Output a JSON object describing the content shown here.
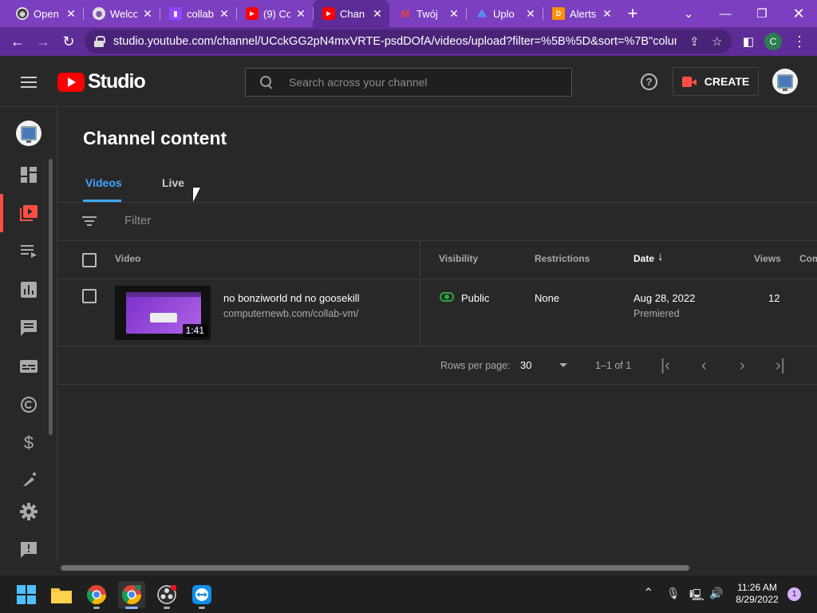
{
  "browser": {
    "tabs": [
      {
        "title": "Open",
        "icon": "github-icon",
        "color": "#e0e0e0"
      },
      {
        "title": "Welco",
        "icon": "globe-icon",
        "color": "#e0e0e0"
      },
      {
        "title": "collab",
        "icon": "twitch-icon",
        "color": "#9146ff"
      },
      {
        "title": "(9) Co",
        "icon": "youtube-icon",
        "color": "#ff0000"
      },
      {
        "title": "Chan",
        "icon": "youtube-icon",
        "color": "#ff0000"
      },
      {
        "title": "Twój",
        "icon": "gmail-icon",
        "color": "#ea4335"
      },
      {
        "title": "Uplo",
        "icon": "upload-icon",
        "color": "#4fa3ff"
      },
      {
        "title": "Alerts",
        "icon": "alerts-icon",
        "color": "#ff9000"
      }
    ],
    "active_tab_index": 4,
    "url": "studio.youtube.com/channel/UCckGG2pN4mxVRTE-psdDOfA/videos/upload?filter=%5B%5D&sort=%7B\"column...",
    "profile_initial": "C"
  },
  "header": {
    "logo_text": "Studio",
    "search_placeholder": "Search across your channel",
    "create_label": "CREATE"
  },
  "sidebar": {
    "items": [
      {
        "name": "dashboard-icon"
      },
      {
        "name": "content-icon",
        "active": true
      },
      {
        "name": "playlists-icon"
      },
      {
        "name": "analytics-icon"
      },
      {
        "name": "comments-icon"
      },
      {
        "name": "subtitles-icon"
      },
      {
        "name": "copyright-icon"
      },
      {
        "name": "earn-icon"
      },
      {
        "name": "customization-icon"
      },
      {
        "name": "settings-icon"
      },
      {
        "name": "feedback-icon"
      }
    ]
  },
  "main": {
    "title": "Channel content",
    "tabs": [
      {
        "label": "Videos",
        "active": true
      },
      {
        "label": "Live",
        "active": false
      }
    ],
    "filter_placeholder": "Filter",
    "columns": {
      "video": "Video",
      "visibility": "Visibility",
      "restrictions": "Restrictions",
      "date": "Date",
      "views": "Views",
      "comments": "Com"
    },
    "rows": [
      {
        "title": "no bonziworld nd no goosekill",
        "description": "computernewb.com/collab-vm/",
        "duration": "1:41",
        "visibility": "Public",
        "restrictions": "None",
        "date": "Aug 28, 2022",
        "date_sub": "Premiered",
        "views": "12"
      }
    ],
    "pagination": {
      "rows_per_page_label": "Rows per page:",
      "rows_per_page": "30",
      "range": "1–1 of 1"
    }
  },
  "taskbar": {
    "time": "11:26 AM",
    "date": "8/29/2022",
    "notification_count": "1"
  }
}
